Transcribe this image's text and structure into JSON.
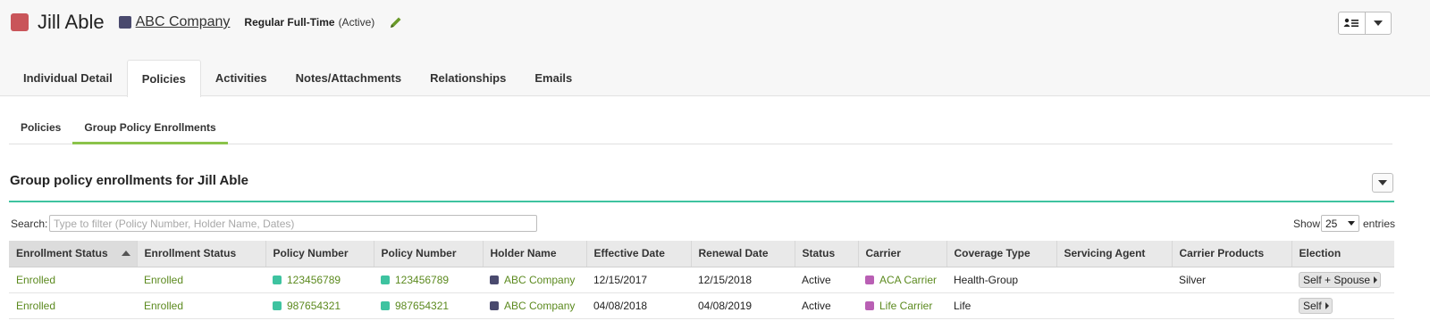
{
  "header": {
    "person_name": "Jill Able",
    "person_color": "#c9555a",
    "company_name": "ABC Company",
    "company_color": "#4a4a6e",
    "employment_type": "Regular Full-Time",
    "employment_status": "(Active)",
    "edit_icon": "pencil-icon",
    "actions": [
      "person-list-icon",
      "chevron-down-icon"
    ]
  },
  "main_tabs": [
    {
      "label": "Individual Detail",
      "active": false
    },
    {
      "label": "Policies",
      "active": true
    },
    {
      "label": "Activities",
      "active": false
    },
    {
      "label": "Notes/Attachments",
      "active": false
    },
    {
      "label": "Relationships",
      "active": false
    },
    {
      "label": "Emails",
      "active": false
    }
  ],
  "sub_tabs": [
    {
      "label": "Policies",
      "active": false
    },
    {
      "label": "Group Policy Enrollments",
      "active": true
    }
  ],
  "section": {
    "title": "Group policy enrollments for Jill Able",
    "underline_color": "#3ec3a0",
    "menu_icon": "chevron-down-icon"
  },
  "search": {
    "label": "Search:",
    "placeholder": "Type to filter (Policy Number, Holder Name, Dates)",
    "value": ""
  },
  "pagination": {
    "show_label": "Show",
    "page_size": "25",
    "entries_label": "entries"
  },
  "table": {
    "columns": [
      "Enrollment Status",
      "Enrollment Status",
      "Policy Number",
      "Policy Number",
      "Holder Name",
      "Effective Date",
      "Renewal Date",
      "Status",
      "Carrier",
      "Coverage Type",
      "Servicing Agent",
      "Carrier Products",
      "Election"
    ],
    "sorted_column": 0,
    "rows": [
      {
        "enrollment_status_1": "Enrolled",
        "enrollment_status_2": "Enrolled",
        "policy_number_1": "123456789",
        "policy_number_2": "123456789",
        "holder_name": "ABC Company",
        "effective_date": "12/15/2017",
        "renewal_date": "12/15/2018",
        "status": "Active",
        "carrier": "ACA Carrier",
        "coverage_type": "Health-Group",
        "servicing_agent": "",
        "carrier_products": "Silver",
        "election": "Self + Spouse"
      },
      {
        "enrollment_status_1": "Enrolled",
        "enrollment_status_2": "Enrolled",
        "policy_number_1": "987654321",
        "policy_number_2": "987654321",
        "holder_name": "ABC Company",
        "effective_date": "04/08/2018",
        "renewal_date": "04/08/2019",
        "status": "Active",
        "carrier": "Life Carrier",
        "coverage_type": "Life",
        "servicing_agent": "",
        "carrier_products": "",
        "election": "Self"
      }
    ]
  },
  "colors": {
    "link_green": "#5c8a1f",
    "accent_teal": "#3ec3a0",
    "tab_underline": "#8bc34a",
    "carrier_purple": "#b95fb4"
  }
}
